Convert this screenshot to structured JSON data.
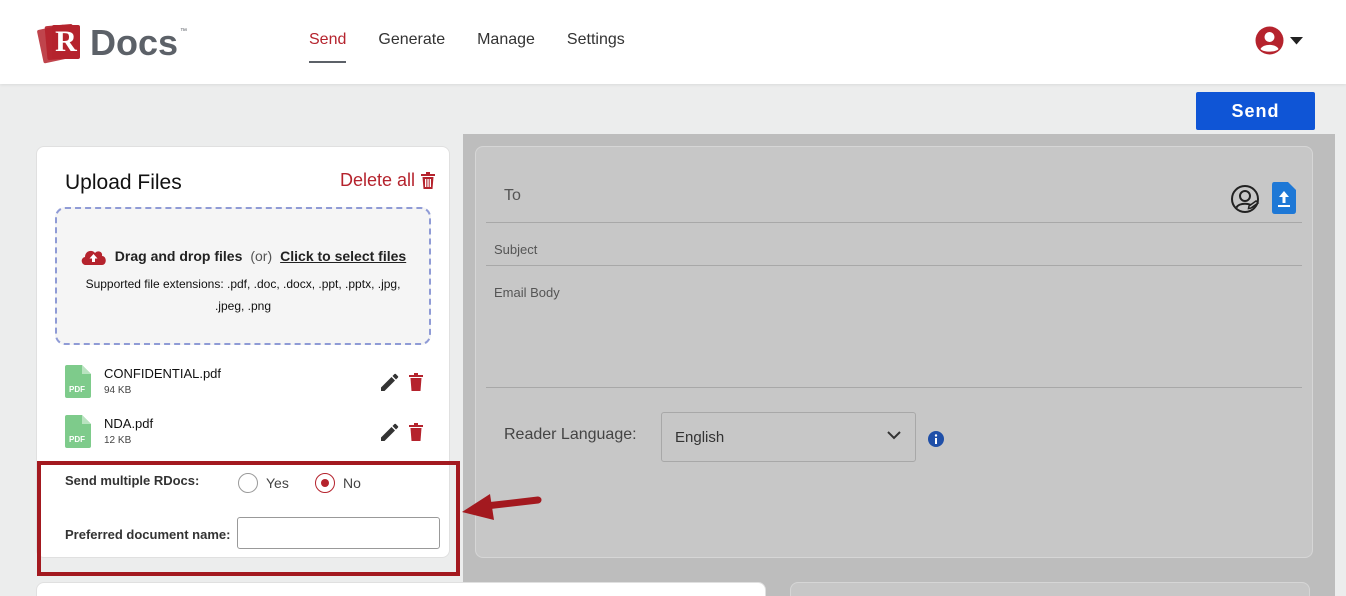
{
  "header": {
    "logo_text": "Docs",
    "logo_letter": "R",
    "logo_tm": "™",
    "nav": [
      {
        "label": "Send",
        "active": true
      },
      {
        "label": "Generate",
        "active": false
      },
      {
        "label": "Manage",
        "active": false
      },
      {
        "label": "Settings",
        "active": false
      }
    ],
    "user_icon": "user-circle-icon"
  },
  "actions": {
    "send_label": "Send"
  },
  "upload": {
    "title": "Upload Files",
    "delete_all": "Delete all",
    "dropzone": {
      "drag_text": "Drag and drop files",
      "or_text": "(or)",
      "select_link": "Click to select files",
      "extensions": "Supported file extensions: .pdf, .doc, .docx, .ppt, .pptx, .jpg, .jpeg, .png"
    },
    "files": [
      {
        "name": "CONFIDENTIAL.pdf",
        "size": "94 KB",
        "type": "PDF"
      },
      {
        "name": "NDA.pdf",
        "size": "12 KB",
        "type": "PDF"
      }
    ],
    "options": {
      "multiple_label": "Send multiple RDocs:",
      "yes_label": "Yes",
      "no_label": "No",
      "selected": "No",
      "doc_name_label": "Preferred document name:",
      "doc_name_value": ""
    }
  },
  "email": {
    "to_label": "To",
    "subject_label": "Subject",
    "body_label": "Email Body",
    "reader_language_label": "Reader Language:",
    "reader_language_value": "English"
  },
  "colors": {
    "brand_red": "#b5232d",
    "primary_blue": "#0f55d6",
    "annotation_red": "#a3191f",
    "file_green": "#7ecb8b"
  }
}
